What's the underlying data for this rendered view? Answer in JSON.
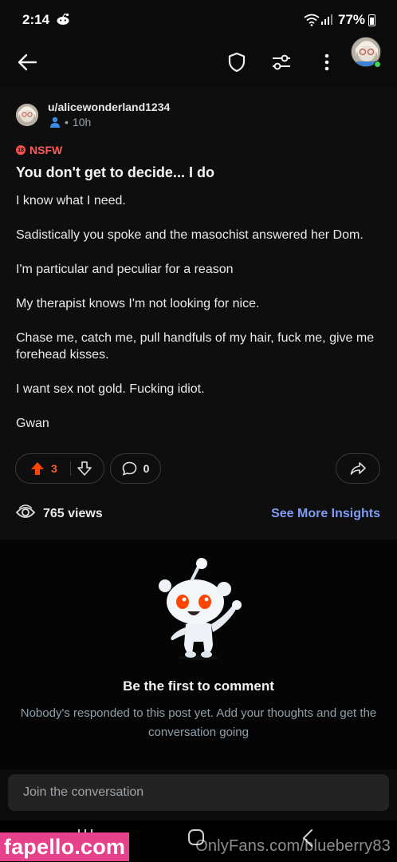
{
  "status_bar": {
    "time": "2:14",
    "battery": "77%",
    "app_icon": "reddit-snoo-icon",
    "wifi_icon": "wifi-icon",
    "signal_icon": "signal-icon"
  },
  "app_bar": {
    "back_icon": "arrow-left-icon",
    "mod_icon": "shield-icon",
    "filter_icon": "sliders-icon",
    "more_icon": "more-vertical-icon",
    "avatar_icon": "user-avatar"
  },
  "post": {
    "author": "u/alicewonderland1234",
    "age": "10h",
    "meta_separator": "•",
    "nsfw_badge": "18",
    "nsfw_label": "NSFW",
    "title": "You don't get to decide... I do",
    "paragraphs": [
      "I know what I need.",
      "Sadistically you spoke and the masochist answered her Dom.",
      "I'm particular and peculiar for a reason",
      "My therapist knows I'm not looking for nice.",
      "Chase me, catch me, pull handfuls of my hair, fuck me, give me forehead kisses.",
      "I want sex not gold. Fucking idiot.",
      "Gwan"
    ],
    "upvotes": "3",
    "comments": "0",
    "views": "765 views",
    "insights_link": "See More Insights"
  },
  "empty_state": {
    "title": "Be the first to comment",
    "subtitle": "Nobody's responded to this post yet. Add your thoughts and get the conversation going"
  },
  "composer": {
    "placeholder": "Join the conversation"
  },
  "watermark": {
    "badge": "fapello.com",
    "text": "OnlyFans.com/blueberry83"
  },
  "colors": {
    "upvote": "#ff4500",
    "nsfw": "#ff5b5b",
    "link": "#7f9cf5",
    "online": "#46d160",
    "watermark_badge": "#e6418b"
  }
}
